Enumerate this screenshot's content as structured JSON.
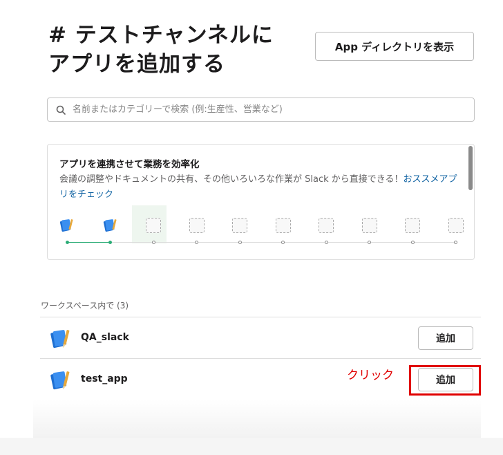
{
  "header": {
    "title": "# テストチャンネルにアプリを追加する",
    "directory_button": "App ディレクトリを表示"
  },
  "search": {
    "placeholder": "名前またはカテゴリーで検索 (例:生産性、営業など)"
  },
  "promo": {
    "title": "アプリを連携させて業務を効率化",
    "description": "会議の調整やドキュメントの共有、その他いろいろな作業が Slack から直接できる！",
    "link_label": "おススメアプリをチェック",
    "slots_filled": 2,
    "slots_total": 10
  },
  "workspace": {
    "section_label": "ワークスペース内で (3)",
    "apps": [
      {
        "name": "QA_slack",
        "add_label": "追加",
        "icon": "notebook-icon"
      },
      {
        "name": "test_app",
        "add_label": "追加",
        "icon": "notebook-icon"
      }
    ]
  },
  "annotation": {
    "text": "クリック",
    "color": "#e00000"
  },
  "colors": {
    "link": "#1264a3",
    "progress": "#2bac76",
    "annotation": "#e00000"
  }
}
